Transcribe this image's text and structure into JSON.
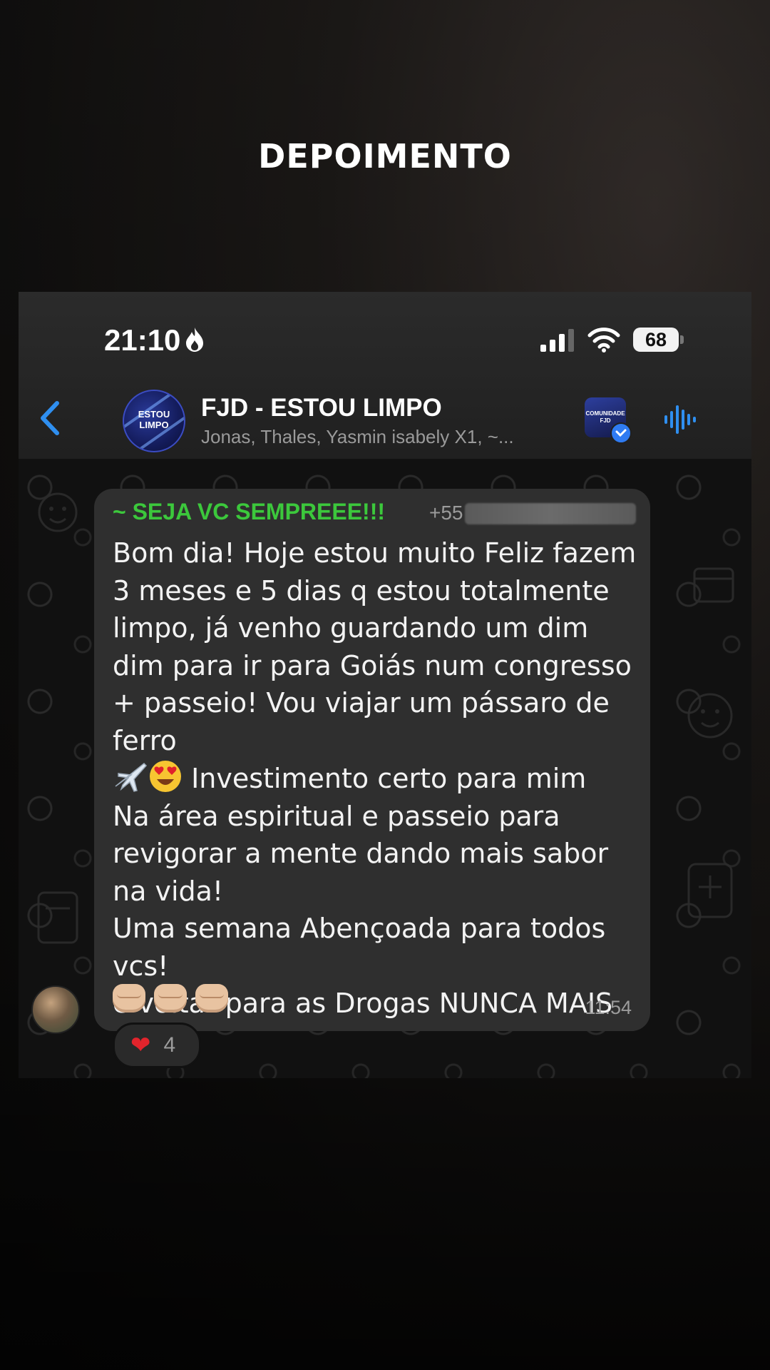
{
  "headline": "DEPOIMENTO",
  "status_bar": {
    "time": "21:10",
    "battery": "68"
  },
  "chat_header": {
    "title": "FJD - ESTOU LIMPO",
    "subtitle": "Jonas, Thales, Yasmin isabely X1, ~...",
    "group_avatar_text": "ESTOU LIMPO",
    "community_icon_text": "COMUNIDADE FJD"
  },
  "message": {
    "sender": "~ SEJA VC SEMPREEE!!!",
    "sender_phone": "+55",
    "text_part1": "Bom dia! Hoje estou muito Feliz fazem 3 meses e 5 dias  q estou totalmente limpo,  já venho guardando um dim dim para ir para Goiás num congresso + passeio! Vou viajar um pássaro de ferro",
    "text_part2": " Investimento certo para mim\nNa área espiritual e passeio para revigorar a mente dando mais sabor na vida!\nUma semana Abençoada para todos vcs!\ne voltar para as Drogas NUNCA MAIS",
    "time": "11:54",
    "reaction": {
      "emoji": "❤",
      "count": "4"
    }
  },
  "colors": {
    "sender_name": "#3cc83c",
    "accent_blue": "#2f8ff0",
    "bubble": "#2f2f2f"
  },
  "icons": [
    "flame-icon",
    "signal-icon",
    "wifi-icon",
    "back-chevron-icon",
    "voice-call-icon",
    "airplane-icon",
    "heart-eyes-icon",
    "fist-icon"
  ]
}
